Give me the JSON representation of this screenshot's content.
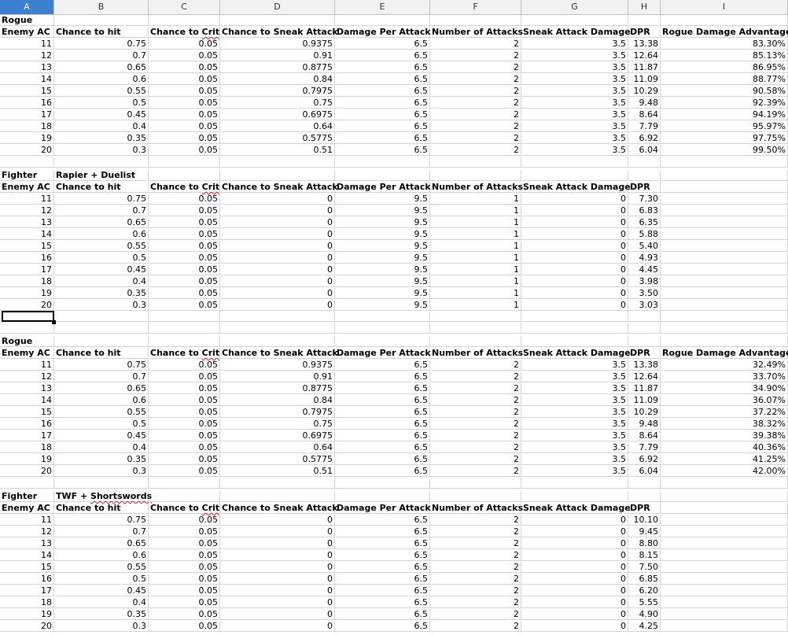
{
  "columns": [
    "A",
    "B",
    "C",
    "D",
    "E",
    "F",
    "G",
    "H",
    "I"
  ],
  "selected_column": "A",
  "blocks": [
    {
      "label": "Rogue",
      "subtitle": "",
      "headers": [
        "Enemy AC",
        "Chance to hit",
        "Chance to Crit",
        "Chance to Sneak Attack",
        "Damage Per Attack",
        "Number of Attacks",
        "Sneak Attack Damage",
        "DPR",
        "Rogue Damage Advantage"
      ],
      "rows": [
        [
          "11",
          "0.75",
          "0.05",
          "0.9375",
          "6.5",
          "2",
          "3.5",
          "13.38",
          "83.30%"
        ],
        [
          "12",
          "0.7",
          "0.05",
          "0.91",
          "6.5",
          "2",
          "3.5",
          "12.64",
          "85.13%"
        ],
        [
          "13",
          "0.65",
          "0.05",
          "0.8775",
          "6.5",
          "2",
          "3.5",
          "11.87",
          "86.95%"
        ],
        [
          "14",
          "0.6",
          "0.05",
          "0.84",
          "6.5",
          "2",
          "3.5",
          "11.09",
          "88.77%"
        ],
        [
          "15",
          "0.55",
          "0.05",
          "0.7975",
          "6.5",
          "2",
          "3.5",
          "10.29",
          "90.58%"
        ],
        [
          "16",
          "0.5",
          "0.05",
          "0.75",
          "6.5",
          "2",
          "3.5",
          "9.48",
          "92.39%"
        ],
        [
          "17",
          "0.45",
          "0.05",
          "0.6975",
          "6.5",
          "2",
          "3.5",
          "8.64",
          "94.19%"
        ],
        [
          "18",
          "0.4",
          "0.05",
          "0.64",
          "6.5",
          "2",
          "3.5",
          "7.79",
          "95.97%"
        ],
        [
          "19",
          "0.35",
          "0.05",
          "0.5775",
          "6.5",
          "2",
          "3.5",
          "6.92",
          "97.75%"
        ],
        [
          "20",
          "0.3",
          "0.05",
          "0.51",
          "6.5",
          "2",
          "3.5",
          "6.04",
          "99.50%"
        ]
      ]
    },
    {
      "label": "Fighter",
      "subtitle": "Rapier + Duelist",
      "headers": [
        "Enemy AC",
        "Chance to hit",
        "Chance to Crit",
        "Chance to Sneak Attack",
        "Damage Per Attack",
        "Number of Attacks",
        "Sneak Attack Damage",
        "DPR",
        ""
      ],
      "rows": [
        [
          "11",
          "0.75",
          "0.05",
          "0",
          "9.5",
          "1",
          "0",
          "7.30",
          ""
        ],
        [
          "12",
          "0.7",
          "0.05",
          "0",
          "9.5",
          "1",
          "0",
          "6.83",
          ""
        ],
        [
          "13",
          "0.65",
          "0.05",
          "0",
          "9.5",
          "1",
          "0",
          "6.35",
          ""
        ],
        [
          "14",
          "0.6",
          "0.05",
          "0",
          "9.5",
          "1",
          "0",
          "5.88",
          ""
        ],
        [
          "15",
          "0.55",
          "0.05",
          "0",
          "9.5",
          "1",
          "0",
          "5.40",
          ""
        ],
        [
          "16",
          "0.5",
          "0.05",
          "0",
          "9.5",
          "1",
          "0",
          "4.93",
          ""
        ],
        [
          "17",
          "0.45",
          "0.05",
          "0",
          "9.5",
          "1",
          "0",
          "4.45",
          ""
        ],
        [
          "18",
          "0.4",
          "0.05",
          "0",
          "9.5",
          "1",
          "0",
          "3.98",
          ""
        ],
        [
          "19",
          "0.35",
          "0.05",
          "0",
          "9.5",
          "1",
          "0",
          "3.50",
          ""
        ],
        [
          "20",
          "0.3",
          "0.05",
          "0",
          "9.5",
          "1",
          "0",
          "3.03",
          ""
        ]
      ]
    },
    {
      "label": "Rogue",
      "subtitle": "",
      "headers": [
        "Enemy AC",
        "Chance to hit",
        "Chance to Crit",
        "Chance to Sneak Attack",
        "Damage Per Attack",
        "Number of Attacks",
        "Sneak Attack Damage",
        "DPR",
        "Rogue Damage Advantage"
      ],
      "rows": [
        [
          "11",
          "0.75",
          "0.05",
          "0.9375",
          "6.5",
          "2",
          "3.5",
          "13.38",
          "32.49%"
        ],
        [
          "12",
          "0.7",
          "0.05",
          "0.91",
          "6.5",
          "2",
          "3.5",
          "12.64",
          "33.70%"
        ],
        [
          "13",
          "0.65",
          "0.05",
          "0.8775",
          "6.5",
          "2",
          "3.5",
          "11.87",
          "34.90%"
        ],
        [
          "14",
          "0.6",
          "0.05",
          "0.84",
          "6.5",
          "2",
          "3.5",
          "11.09",
          "36.07%"
        ],
        [
          "15",
          "0.55",
          "0.05",
          "0.7975",
          "6.5",
          "2",
          "3.5",
          "10.29",
          "37.22%"
        ],
        [
          "16",
          "0.5",
          "0.05",
          "0.75",
          "6.5",
          "2",
          "3.5",
          "9.48",
          "38.32%"
        ],
        [
          "17",
          "0.45",
          "0.05",
          "0.6975",
          "6.5",
          "2",
          "3.5",
          "8.64",
          "39.38%"
        ],
        [
          "18",
          "0.4",
          "0.05",
          "0.64",
          "6.5",
          "2",
          "3.5",
          "7.79",
          "40.36%"
        ],
        [
          "19",
          "0.35",
          "0.05",
          "0.5775",
          "6.5",
          "2",
          "3.5",
          "6.92",
          "41.25%"
        ],
        [
          "20",
          "0.3",
          "0.05",
          "0.51",
          "6.5",
          "2",
          "3.5",
          "6.04",
          "42.00%"
        ]
      ]
    },
    {
      "label": "Fighter",
      "subtitle": "TWF + Shortswords",
      "headers": [
        "Enemy AC",
        "Chance to hit",
        "Chance to Crit",
        "Chance to Sneak Attack",
        "Damage Per Attack",
        "Number of Attacks",
        "Sneak Attack Damage",
        "DPR",
        ""
      ],
      "rows": [
        [
          "11",
          "0.75",
          "0.05",
          "0",
          "6.5",
          "2",
          "0",
          "10.10",
          ""
        ],
        [
          "12",
          "0.7",
          "0.05",
          "0",
          "6.5",
          "2",
          "0",
          "9.45",
          ""
        ],
        [
          "13",
          "0.65",
          "0.05",
          "0",
          "6.5",
          "2",
          "0",
          "8.80",
          ""
        ],
        [
          "14",
          "0.6",
          "0.05",
          "0",
          "6.5",
          "2",
          "0",
          "8.15",
          ""
        ],
        [
          "15",
          "0.55",
          "0.05",
          "0",
          "6.5",
          "2",
          "0",
          "7.50",
          ""
        ],
        [
          "16",
          "0.5",
          "0.05",
          "0",
          "6.5",
          "2",
          "0",
          "6.85",
          ""
        ],
        [
          "17",
          "0.45",
          "0.05",
          "0",
          "6.5",
          "2",
          "0",
          "6.20",
          ""
        ],
        [
          "18",
          "0.4",
          "0.05",
          "0",
          "6.5",
          "2",
          "0",
          "5.55",
          ""
        ],
        [
          "19",
          "0.35",
          "0.05",
          "0",
          "6.5",
          "2",
          "0",
          "4.90",
          ""
        ],
        [
          "20",
          "0.3",
          "0.05",
          "0",
          "6.5",
          "2",
          "0",
          "4.25",
          ""
        ]
      ]
    }
  ]
}
